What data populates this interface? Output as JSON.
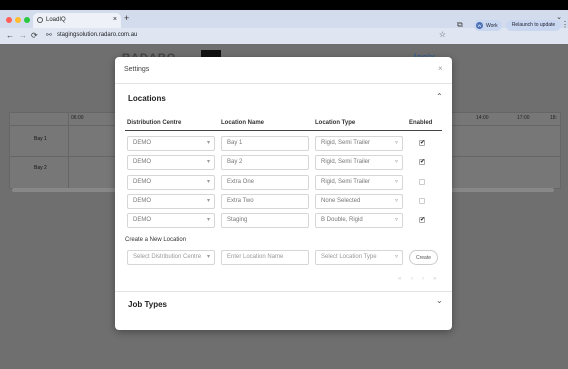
{
  "browser": {
    "tab_title": "LoadIQ",
    "tab_close": "×",
    "new_tab": "+",
    "url": "stagingsolution.radaro.com.au",
    "profile_initial": "W",
    "profile_label": "Work",
    "relaunch_label": "Relaunch to update",
    "nav": {
      "back": "←",
      "forward": "→",
      "reload": "⟳"
    },
    "icons": {
      "tune": "⚯",
      "star": "☆",
      "extension": "⧉",
      "kebab": "⋮",
      "tabs_chevron": "⌄"
    },
    "colors": {
      "close_dot": "#ff5f57",
      "min_dot": "#febc2e",
      "max_dot": "#28c840",
      "toolbar": "#dfe6f2"
    }
  },
  "background_page": {
    "logo": "RADARO",
    "brand": "loqix",
    "times": [
      "06:00",
      "14:00",
      "17:00",
      "18:"
    ],
    "rows": [
      "Bay 1",
      "Bay 2"
    ]
  },
  "settings": {
    "title": "Settings",
    "close": "×",
    "locations_section": {
      "title": "Locations",
      "toggle": "⌃",
      "headers": [
        "Distribution Centre",
        "Location Name",
        "Location Type",
        "Enabled"
      ],
      "rows": [
        {
          "centre": "DEMO",
          "name": "Bay 1",
          "type": "Rigid, Semi Trailer",
          "enabled": true
        },
        {
          "centre": "DEMO",
          "name": "Bay 2",
          "type": "Rigid, Semi Trailer",
          "enabled": true
        },
        {
          "centre": "DEMO",
          "name": "Extra One",
          "type": "Rigid, Semi Trailer",
          "enabled": false
        },
        {
          "centre": "DEMO",
          "name": "Extra Two",
          "type": "None Selected",
          "enabled": false
        },
        {
          "centre": "DEMO",
          "name": "Staging",
          "type": "B Double, Rigid",
          "enabled": true
        }
      ],
      "create_new_label": "Create a New Location",
      "new_location": {
        "centre_placeholder": "Select Distribution Centre",
        "name_placeholder": "Enter Location Name",
        "type_placeholder": "Select Location Type",
        "create_button": "Create"
      },
      "pagination": [
        "«",
        "‹",
        "›",
        "»"
      ]
    },
    "job_types_section": {
      "title": "Job Types",
      "toggle": "⌄"
    },
    "dropdown_arrow": "▾",
    "type_arrow": "▿",
    "check": "✔"
  }
}
